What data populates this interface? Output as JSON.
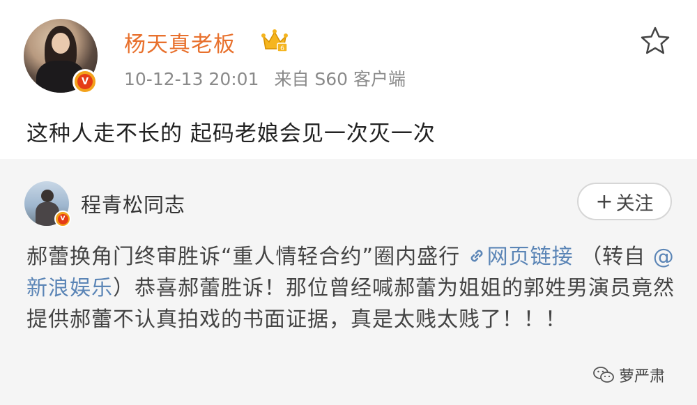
{
  "post": {
    "username": "杨天真老板",
    "time": "10-12-13 20:01",
    "source": "来自 S60 客户端",
    "text": "这种人走不长的 起码老娘会见一次灭一次"
  },
  "repost": {
    "username": "程青松同志",
    "follow_label": "关注",
    "body_part1": "郝蕾换角门终审胜诉“重人情轻合约”圈内盛行 ",
    "link_label": "网页链接",
    "body_part2": " （转自 ",
    "mention": "@新浪娱乐",
    "body_part3": "）恭喜郝蕾胜诉！那位曾经喊郝蕾为姐姐的郭姓男演员竟然提供郝蕾不认真拍戏的书面证据，真是太贱太贱了！！！"
  },
  "watermark": {
    "label": "萝严肃"
  },
  "icons": {
    "verified": "v-badge-icon",
    "crown": "crown-icon",
    "star": "star-icon",
    "link": "link-icon",
    "wechat": "wechat-icon"
  },
  "colors": {
    "username": "#e8702c",
    "link": "#5b85b6",
    "repost_bg": "#f5f5f5",
    "meta": "#8a8a8a"
  }
}
